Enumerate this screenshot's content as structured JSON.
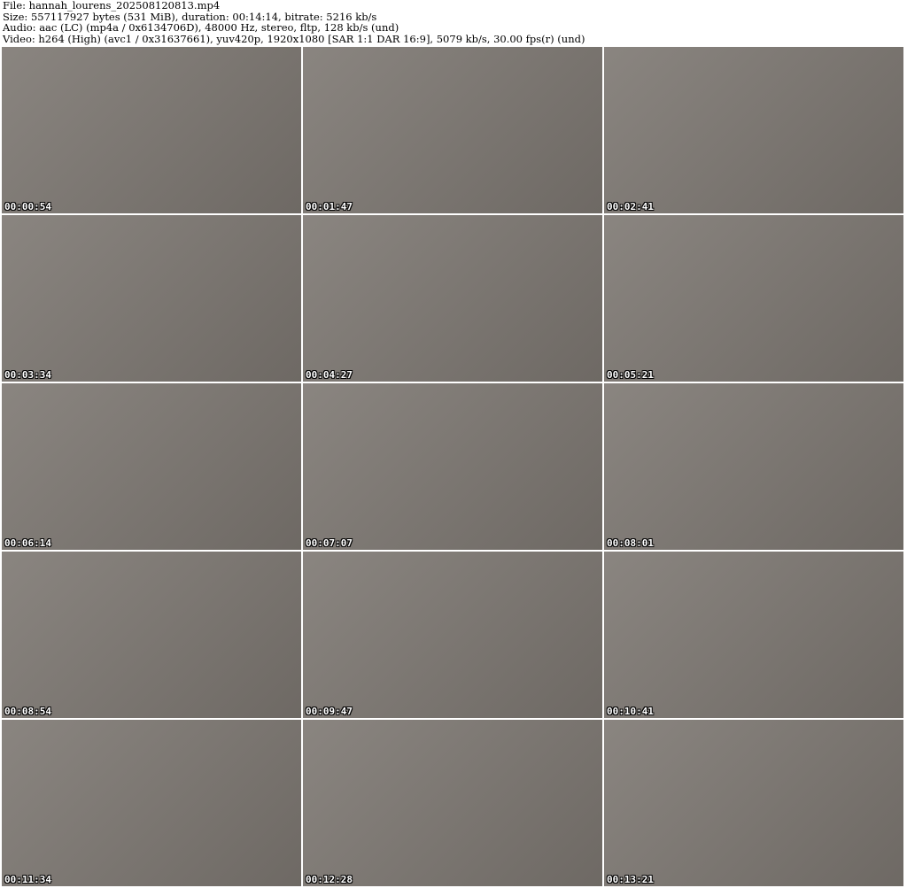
{
  "header": {
    "file": "File: hannah_lourens_202508120813.mp4",
    "size": "Size: 557117927 bytes (531 MiB), duration: 00:14:14, bitrate: 5216 kb/s",
    "audio": "Audio: aac (LC) (mp4a / 0x6134706D), 48000 Hz, stereo, fltp, 128 kb/s (und)",
    "video": "Video: h264 (High) (avc1 / 0x31637661), yuv420p, 1920x1080 [SAR 1:1 DAR 16:9], 5079 kb/s, 30.00 fps(r) (und)"
  },
  "thumbnails": [
    {
      "timestamp": "00:00:54"
    },
    {
      "timestamp": "00:01:47"
    },
    {
      "timestamp": "00:02:41"
    },
    {
      "timestamp": "00:03:34"
    },
    {
      "timestamp": "00:04:27"
    },
    {
      "timestamp": "00:05:21"
    },
    {
      "timestamp": "00:06:14"
    },
    {
      "timestamp": "00:07:07"
    },
    {
      "timestamp": "00:08:01"
    },
    {
      "timestamp": "00:08:54"
    },
    {
      "timestamp": "00:09:47"
    },
    {
      "timestamp": "00:10:41"
    },
    {
      "timestamp": "00:11:34"
    },
    {
      "timestamp": "00:12:28"
    },
    {
      "timestamp": "00:13:21"
    }
  ]
}
